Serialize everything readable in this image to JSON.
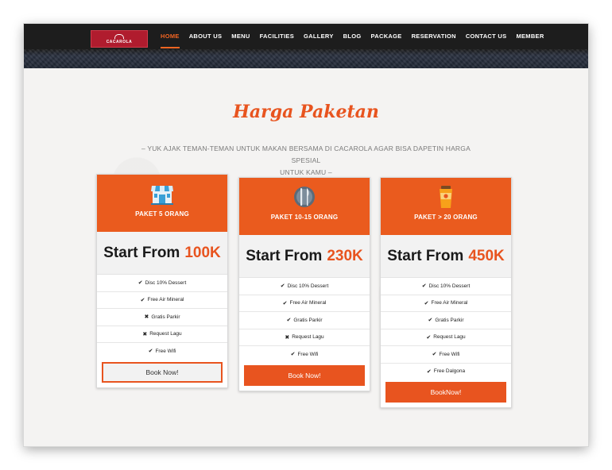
{
  "brand": {
    "logo_text": "CACAROLA"
  },
  "nav": {
    "items": [
      "HOME",
      "ABOUT US",
      "MENU",
      "FACILITIES",
      "GALLERY",
      "BLOG",
      "PACKAGE",
      "RESERVATION",
      "CONTACT US",
      "MEMBER"
    ],
    "active": "HOME"
  },
  "section": {
    "title": "Harga Paketan",
    "subtitle_line1": "– YUK AJAK TEMAN-TEMAN UNTUK MAKAN BERSAMA DI CACAROLA AGAR BISA DAPETIN HARGA SPESIAL",
    "subtitle_line2": "UNTUK KAMU –"
  },
  "colors": {
    "accent": "#e8541f",
    "header_bg": "#1d1d1d",
    "page_bg": "#f4f3f2"
  },
  "cards": [
    {
      "icon": "storefront-icon",
      "name": "PAKET 5 ORANG",
      "price_prefix": "Start From",
      "price_amount": "100K",
      "features": [
        {
          "mark": "✔",
          "text": "Disc 10% Dessert"
        },
        {
          "mark": "✔",
          "text": "Free Air Mineral"
        },
        {
          "mark": "✖",
          "text": "Gratis Parkir"
        },
        {
          "mark": "✖",
          "text": "Request Lagu"
        },
        {
          "mark": "✔",
          "text": "Free Wifi"
        }
      ],
      "button": "Book Now!"
    },
    {
      "icon": "plate-cutlery-icon",
      "name": "PAKET 10-15 ORANG",
      "price_prefix": "Start From",
      "price_amount": "230K",
      "features": [
        {
          "mark": "✔",
          "text": "Disc 10% Dessert"
        },
        {
          "mark": "✔",
          "text": "Free Air Mineral"
        },
        {
          "mark": "✔",
          "text": "Gratis Parkir"
        },
        {
          "mark": "✖",
          "text": "Request Lagu"
        },
        {
          "mark": "✔",
          "text": "Free Wifi"
        }
      ],
      "button": "Book Now!"
    },
    {
      "icon": "drink-cup-icon",
      "name": "PAKET > 20 ORANG",
      "price_prefix": "Start From",
      "price_amount": "450K",
      "features": [
        {
          "mark": "✔",
          "text": "Disc 10% Dessert"
        },
        {
          "mark": "✔",
          "text": "Free Air Mineral"
        },
        {
          "mark": "✔",
          "text": "Gratis Parkir"
        },
        {
          "mark": "✔",
          "text": "Request Lagu"
        },
        {
          "mark": "✔",
          "text": "Free Wifi"
        },
        {
          "mark": "✔",
          "text": "Free Dalgona"
        }
      ],
      "button": "BookNow!"
    }
  ]
}
